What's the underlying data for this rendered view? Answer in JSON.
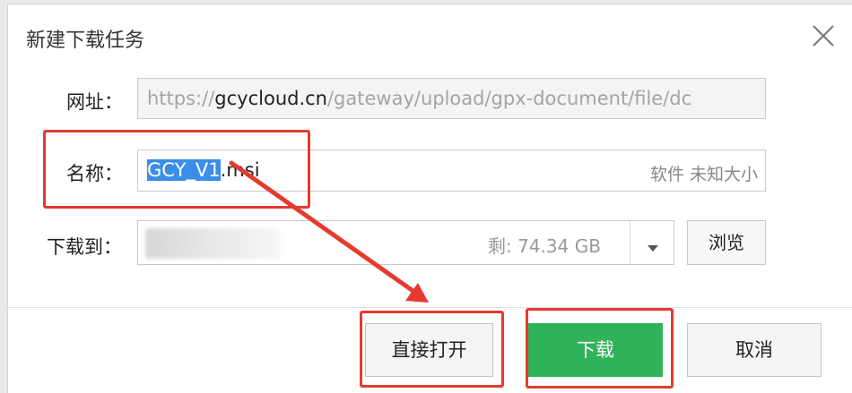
{
  "dialog": {
    "title": "新建下载任务",
    "close_icon": "close-icon"
  },
  "form": {
    "url_label": "网址：",
    "url_prefix": "https://",
    "url_domain": "gcycloud.cn",
    "url_path": "/gateway/upload/gpx-document/file/dc",
    "name_label": "名称：",
    "name_selected": "GCY_V1",
    "name_rest": ".msi",
    "name_meta": "软件 未知大小",
    "saveto_label": "下载到：",
    "free_space": "剩: 74.34 GB",
    "browse_label": "浏览"
  },
  "buttons": {
    "open_label": "直接打开",
    "download_label": "下载",
    "cancel_label": "取消"
  },
  "colors": {
    "download_button": "#2fb259",
    "selection": "#3b8ee8",
    "annotation": "#e53a2e"
  }
}
